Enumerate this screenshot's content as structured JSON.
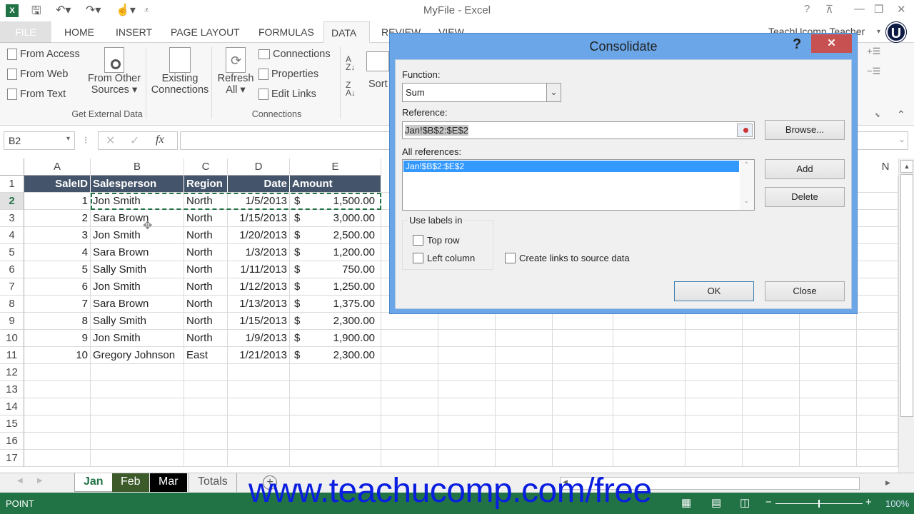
{
  "window": {
    "title": "MyFile - Excel",
    "controls": [
      "?",
      "restore-ribbon",
      "minimize",
      "maximize",
      "close"
    ]
  },
  "tabs": {
    "file": "FILE",
    "items": [
      "HOME",
      "INSERT",
      "PAGE LAYOUT",
      "FORMULAS",
      "DATA",
      "REVIEW",
      "VIEW"
    ],
    "active": "DATA",
    "user": "TeachUcomp Teacher",
    "user_badge": "U"
  },
  "ribbon": {
    "get_external_data": {
      "label": "Get External Data",
      "from_access": "From Access",
      "from_web": "From Web",
      "from_text": "From Text",
      "from_other_1": "From Other",
      "from_other_2": "Sources",
      "existing_1": "Existing",
      "existing_2": "Connections"
    },
    "connections": {
      "label": "Connections",
      "refresh_1": "Refresh",
      "refresh_2": "All",
      "connections": "Connections",
      "properties": "Properties",
      "edit_links": "Edit Links"
    },
    "sort": {
      "sort_label": "Sort",
      "az": "A→Z",
      "za": "Z→A"
    }
  },
  "formula_bar": {
    "name_box": "B2",
    "fx": "fx",
    "value": ""
  },
  "grid": {
    "columns": [
      "A",
      "B",
      "C",
      "D",
      "E",
      "N"
    ],
    "row_numbers": [
      "1",
      "2",
      "3",
      "4",
      "5",
      "6",
      "7",
      "8",
      "9",
      "10",
      "11",
      "12",
      "13",
      "14",
      "15",
      "16",
      "17"
    ],
    "headers": [
      "SaleID",
      "Salesperson",
      "Region",
      "Date",
      "Amount"
    ],
    "rows": [
      [
        "1",
        "Jon Smith",
        "North",
        "1/5/2013",
        "$",
        "1,500.00"
      ],
      [
        "2",
        "Sara Brown",
        "North",
        "1/15/2013",
        "$",
        "3,000.00"
      ],
      [
        "3",
        "Jon Smith",
        "North",
        "1/20/2013",
        "$",
        "2,500.00"
      ],
      [
        "4",
        "Sara Brown",
        "North",
        "1/3/2013",
        "$",
        "1,200.00"
      ],
      [
        "5",
        "Sally Smith",
        "North",
        "1/11/2013",
        "$",
        "750.00"
      ],
      [
        "6",
        "Jon Smith",
        "North",
        "1/12/2013",
        "$",
        "1,250.00"
      ],
      [
        "7",
        "Sara Brown",
        "North",
        "1/13/2013",
        "$",
        "1,375.00"
      ],
      [
        "8",
        "Sally Smith",
        "North",
        "1/15/2013",
        "$",
        "2,300.00"
      ],
      [
        "9",
        "Jon Smith",
        "North",
        "1/9/2013",
        "$",
        "1,900.00"
      ],
      [
        "10",
        "Gregory Johnson",
        "East",
        "1/21/2013",
        "$",
        "2,300.00"
      ]
    ]
  },
  "dialog": {
    "title": "Consolidate",
    "help": "?",
    "close_x": "✕",
    "function_label": "Function:",
    "function_value": "Sum",
    "reference_label": "Reference:",
    "reference_value": "Jan!$B$2:$E$2",
    "browse": "Browse...",
    "all_references_label": "All references:",
    "all_references": [
      "Jan!$B$2:$E$2"
    ],
    "add": "Add",
    "delete": "Delete",
    "use_labels_in": "Use labels in",
    "top_row": "Top row",
    "left_column": "Left column",
    "create_links": "Create links to source data",
    "top_row_checked": false,
    "left_column_checked": false,
    "create_links_checked": false,
    "ok": "OK",
    "close": "Close"
  },
  "sheets": {
    "tabs": [
      "Jan",
      "Feb",
      "Mar",
      "Totals"
    ],
    "active": "Jan",
    "add": "+"
  },
  "status": {
    "mode": "POINT",
    "zoom": "100%"
  },
  "watermark": "www.teachucomp.com/free"
}
